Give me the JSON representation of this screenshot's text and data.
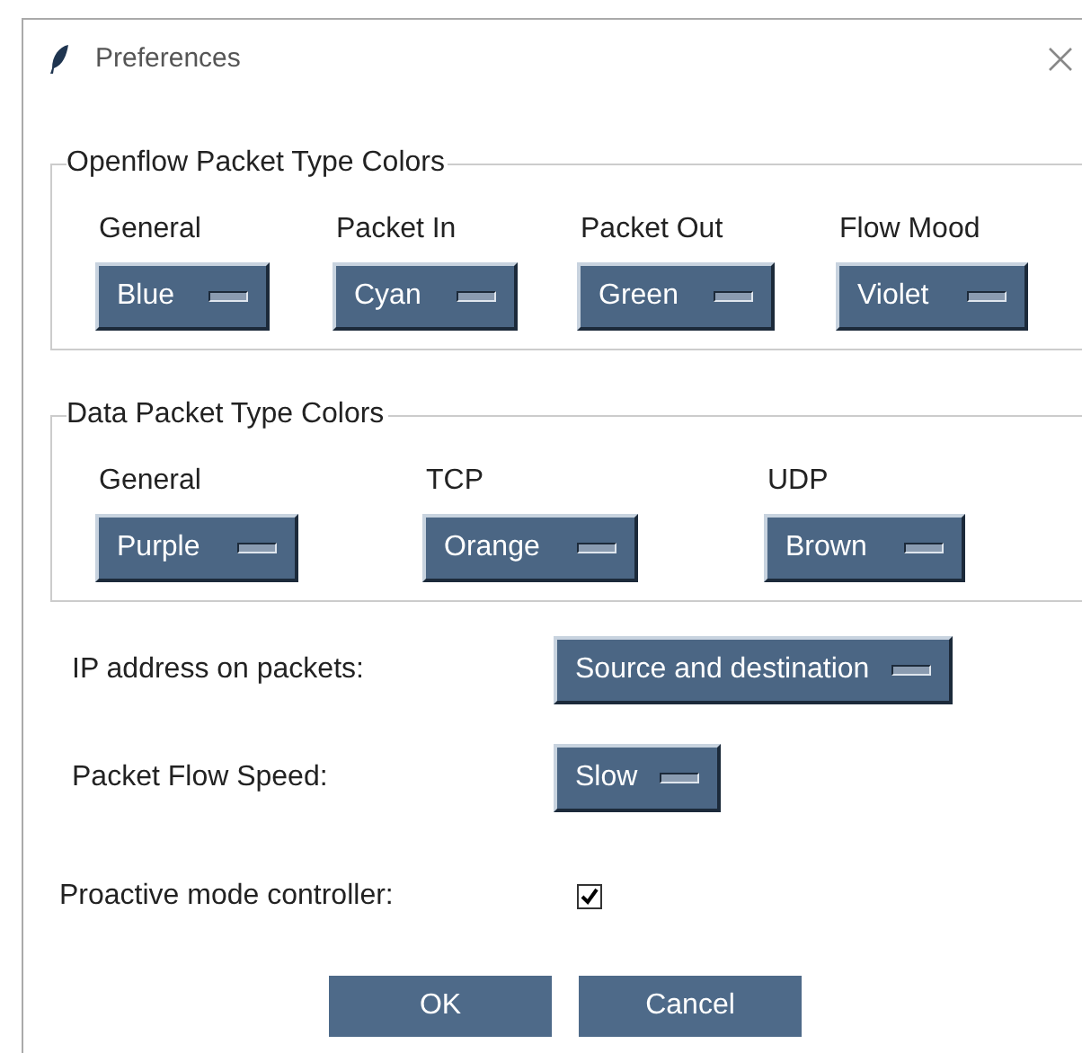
{
  "window": {
    "title": "Preferences"
  },
  "groups": [
    {
      "title": "Openflow Packet Type Colors",
      "items": [
        {
          "label": "General",
          "value": "Blue"
        },
        {
          "label": "Packet In",
          "value": "Cyan"
        },
        {
          "label": "Packet Out",
          "value": "Green"
        },
        {
          "label": "Flow Mood",
          "value": "Violet"
        }
      ]
    },
    {
      "title": "Data Packet Type Colors",
      "items": [
        {
          "label": "General",
          "value": "Purple"
        },
        {
          "label": "TCP",
          "value": "Orange"
        },
        {
          "label": "UDP",
          "value": "Brown"
        }
      ]
    }
  ],
  "options": [
    {
      "kind": "menu",
      "label": "IP address on packets:",
      "value": "Source and destination"
    },
    {
      "kind": "menu",
      "label": "Packet Flow Speed:",
      "value": "Slow"
    },
    {
      "kind": "checkbox",
      "label": "Proactive mode controller:",
      "checked": true
    }
  ],
  "buttons": [
    "OK",
    "Cancel"
  ]
}
